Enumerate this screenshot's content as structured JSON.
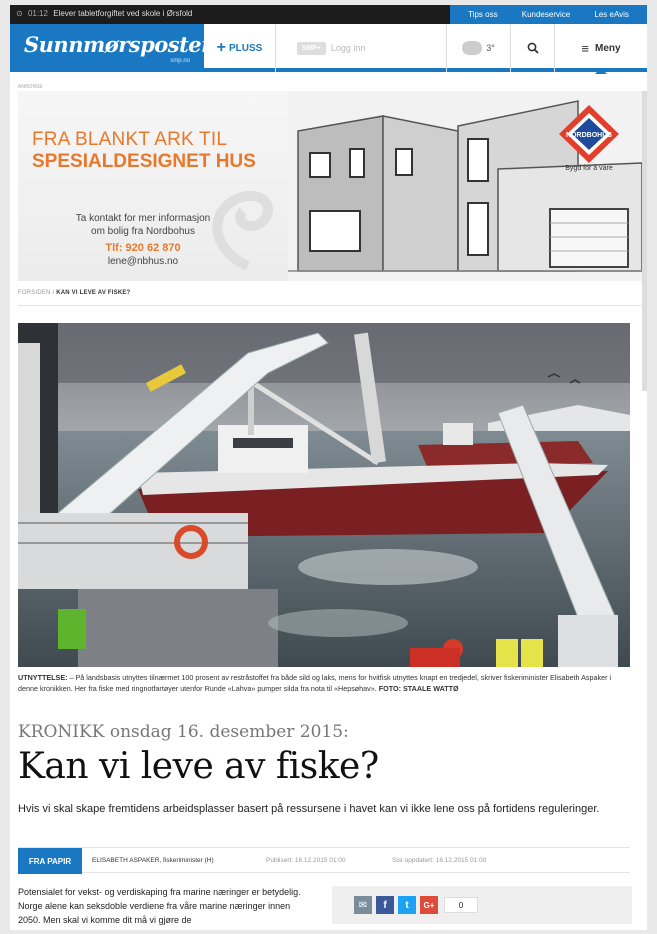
{
  "ticker": {
    "time": "01:12",
    "text": "Elever tabletforgiftet ved skole i Ørsfold"
  },
  "toplinks": [
    "Tips oss",
    "Kundeservice",
    "Les eAvis"
  ],
  "header": {
    "logo": "Sunnmørsposten",
    "logo_sub": "smp.no",
    "pluss": "PLUSS",
    "login_badge": "SMP+",
    "login": "Logg inn",
    "weather_temp": "3°",
    "menu": "Meny",
    "accent": "#1a78c2"
  },
  "ad": {
    "label": "ANNONSE",
    "headline1": "FRA BLANKT ARK TIL",
    "headline2": "SPESIALDESIGNET HUS",
    "contact_line1": "Ta kontakt for mer informasjon",
    "contact_line2": "om bolig fra Nordbohus",
    "phone": "Tlf: 920 62 870",
    "email": "lene@nbhus.no",
    "brand": "NORDBOHUS",
    "tagline": "Bygd for å vare",
    "accent": "#e8782a"
  },
  "breadcrumb": {
    "home": "FORSIDEN",
    "current": "KAN VI LEVE AV FISKE?"
  },
  "photo": {
    "boat_label": ""
  },
  "caption": {
    "label": "UTNYTTELSE:",
    "text": "– På landsbasis utnyttes tilnærmet 100 prosent av restråstoffet fra både sild og laks, mens for hvitfisk utnyttes knapt en tredjedel, skriver fiskeriminister Elisabeth Aspaker i denne kronikken. Her fra fiske med ringnotfartøyer utenfor Runde «Lahva» pumper silda fra nota til «Hepsøhav».",
    "credit": "FOTO: STAALE WATTØ"
  },
  "article": {
    "kicker": "KRONIKK onsdag 16. desember 2015:",
    "headline": "Kan vi leve av fiske?",
    "lede": "Hvis vi skal skape fremtidens arbeidsplasser basert på ressursene i havet kan vi ikke lene oss på fortidens reguleringer.",
    "source_tag": "FRA PAPIR",
    "author": "ELISABETH ASPAKER, fiskeriminister (H)",
    "published": "Publisert: 16.12.2015 01:00",
    "updated": "Sist oppdatert: 16.12.2015 01:00",
    "body": "Potensialet for vekst- og verdiskaping fra marine næringer er betydelig. Norge alene kan seksdoble verdiene fra våre marine næringer innen 2050. Men skal vi komme dit må vi gjøre de"
  },
  "share": {
    "count": "0",
    "colors": {
      "mail": "#7a8b99",
      "facebook": "#3b5998",
      "twitter": "#1da1f2",
      "gplus": "#dd4b39"
    }
  }
}
